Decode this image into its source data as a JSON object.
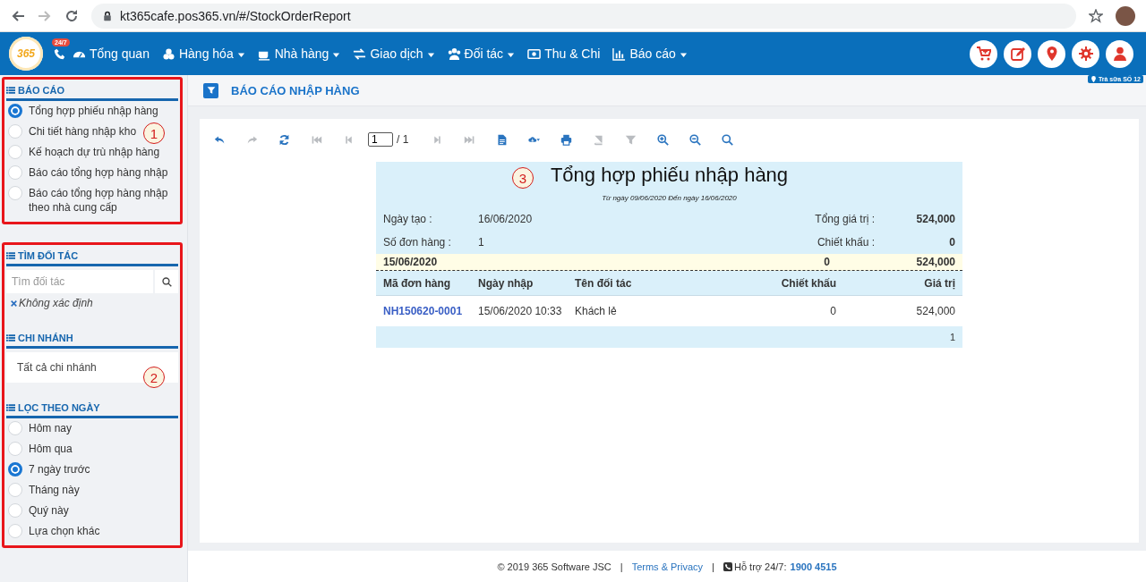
{
  "browser": {
    "url": "kt365cafe.pos365.vn/#/StockOrderReport"
  },
  "navbar": {
    "logo": "365",
    "support_badge": "24/7",
    "menu": [
      {
        "label": "Tổng quan",
        "dropdown": false
      },
      {
        "label": "Hàng hóa",
        "dropdown": true
      },
      {
        "label": "Nhà hàng",
        "dropdown": true
      },
      {
        "label": "Giao dịch",
        "dropdown": true
      },
      {
        "label": "Đối tác",
        "dropdown": true
      },
      {
        "label": "Thu & Chi",
        "dropdown": false
      },
      {
        "label": "Báo cáo",
        "dropdown": true
      }
    ],
    "branch_tag": "Trà sữa SỐ 12"
  },
  "sidebar": {
    "groups": [
      {
        "marker": "1",
        "sections": [
          {
            "kind": "radio",
            "title": "BÁO CÁO",
            "items": [
              {
                "label": "Tổng hợp phiếu nhập hàng",
                "selected": true
              },
              {
                "label": "Chi tiết hàng nhập kho",
                "selected": false
              },
              {
                "label": "Kế hoạch dự trù nhập hàng",
                "selected": false
              },
              {
                "label": "Báo cáo tổng hợp hàng nhập",
                "selected": false
              },
              {
                "label": "Báo cáo tổng hợp hàng nhập theo nhà cung cấp",
                "selected": false
              }
            ]
          }
        ]
      },
      {
        "marker": "2",
        "sections": [
          {
            "kind": "search",
            "title": "TÌM ĐỐI TÁC",
            "placeholder": "Tìm đối tác",
            "chip": "Không xác định"
          },
          {
            "kind": "select",
            "title": "CHI NHÁNH",
            "value": "Tất cả chi nhánh"
          },
          {
            "kind": "radio",
            "title": "LỌC THEO NGÀY",
            "items": [
              {
                "label": "Hôm nay",
                "selected": false
              },
              {
                "label": "Hôm qua",
                "selected": false
              },
              {
                "label": "7 ngày trước",
                "selected": true
              },
              {
                "label": "Tháng này",
                "selected": false
              },
              {
                "label": "Quý này",
                "selected": false
              },
              {
                "label": "Lựa chọn khác",
                "selected": false
              }
            ]
          }
        ]
      }
    ]
  },
  "page": {
    "title": "BÁO CÁO NHẬP HÀNG"
  },
  "toolbar": {
    "tools_before": [
      {
        "disabled": false
      },
      {
        "disabled": true
      },
      {
        "disabled": false
      },
      {
        "disabled": true
      },
      {
        "disabled": true
      }
    ],
    "page_input": "1",
    "page_total": "/ 1",
    "tools_after": [
      {
        "disabled": true
      },
      {
        "disabled": true
      },
      {
        "disabled": false
      },
      {
        "disabled": false
      },
      {
        "disabled": false
      },
      {
        "disabled": true
      },
      {
        "disabled": true
      },
      {
        "disabled": false
      },
      {
        "disabled": false
      },
      {
        "disabled": false
      }
    ]
  },
  "report": {
    "marker": "3",
    "title": "Tổng hợp phiếu nhập hàng",
    "date_range": "Từ ngày 09/06/2020 Đến ngày 16/06/2020",
    "summary": [
      {
        "label": "Ngày tạo :",
        "value": "16/06/2020",
        "label_2": "Tổng giá trị :",
        "value_2": "524,000"
      },
      {
        "label": "Số đơn hàng :",
        "value": "1",
        "label_2": "Chiết khấu :",
        "value_2": "0"
      }
    ],
    "group": {
      "date": "15/06/2020",
      "discount": "0",
      "total": "524,000"
    },
    "columns": [
      "Mã đơn hàng",
      "Ngày nhập",
      "Tên đối tác",
      "Chiết khấu",
      "Giá trị"
    ],
    "rows": [
      [
        "NH150620-0001",
        "15/06/2020 10:33",
        "Khách lẻ",
        "0",
        "524,000"
      ]
    ],
    "footer_count": "1"
  },
  "footer": [
    {
      "kind": "text",
      "text": "© 2019 365 Software JSC"
    },
    {
      "kind": "separator",
      "text": "|"
    },
    {
      "kind": "link",
      "text": "Terms & Privacy"
    },
    {
      "kind": "separator",
      "text": "|"
    },
    {
      "kind": "support",
      "text": "Hỗ trợ 24/7:"
    },
    {
      "kind": "phone",
      "text": "1900 4515"
    }
  ]
}
